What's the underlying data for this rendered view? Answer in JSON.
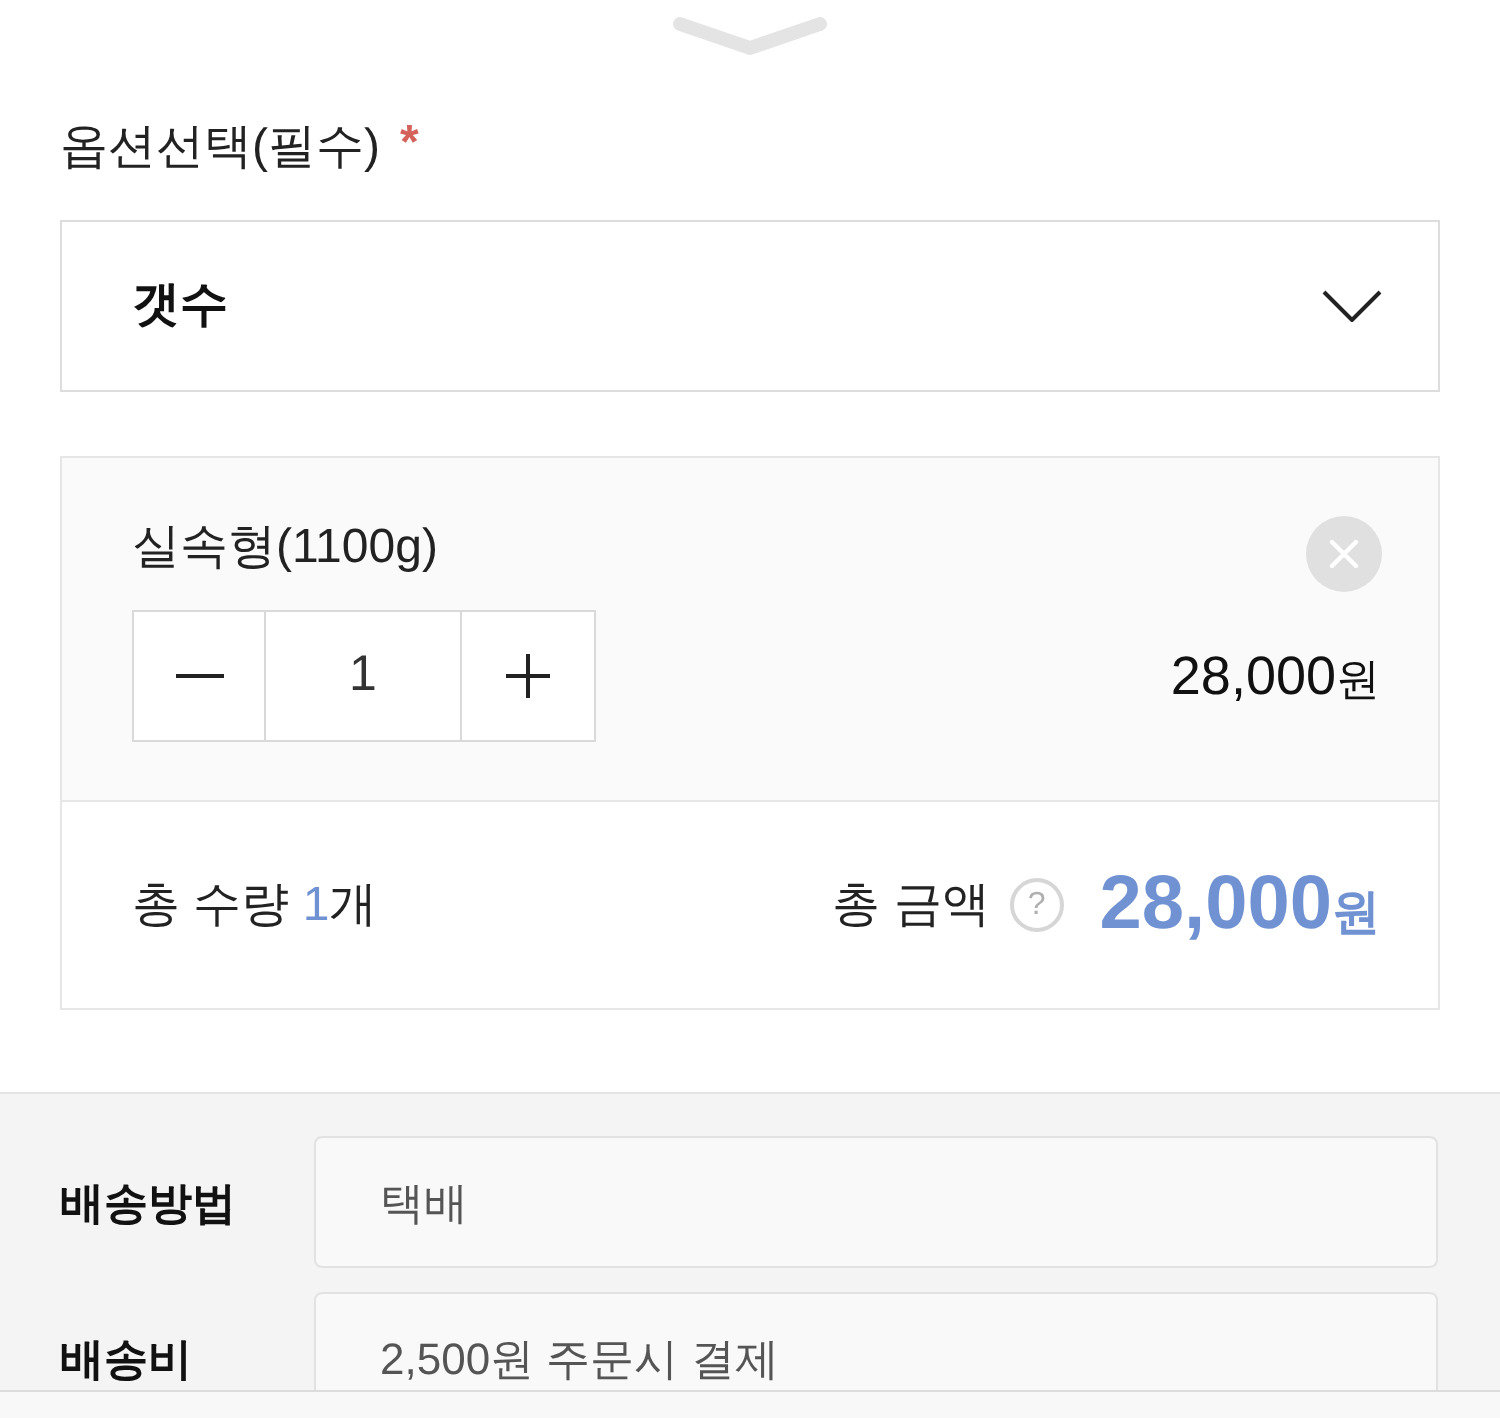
{
  "option_select": {
    "label": "옵션선택(필수)",
    "required_mark": "*",
    "dropdown": {
      "value": "갯수"
    }
  },
  "selected_options": [
    {
      "name": "실속형(1100g)",
      "quantity": "1",
      "price": "28,000",
      "currency": "원"
    }
  ],
  "summary": {
    "quantity_label": "총 수량",
    "quantity": "1",
    "quantity_unit": "개",
    "amount_label": "총 금액",
    "help_mark": "?",
    "amount": "28,000",
    "currency": "원"
  },
  "delivery": [
    {
      "label": "배송방법",
      "value": "택배"
    },
    {
      "label": "배송비",
      "value": "2,500원 주문시 결제"
    }
  ]
}
